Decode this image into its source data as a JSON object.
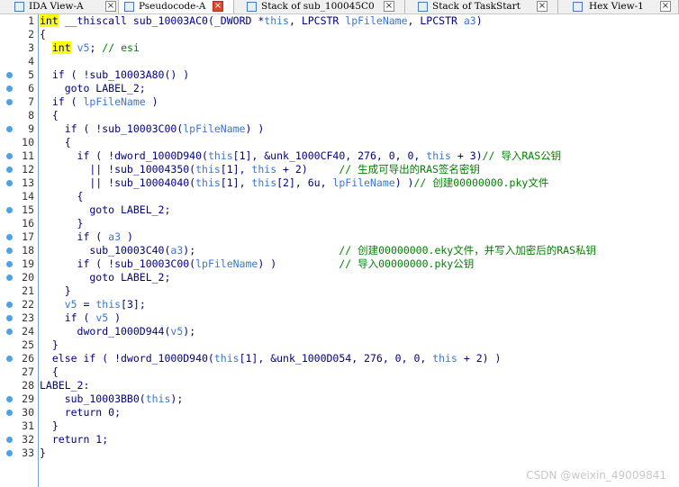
{
  "tabs": [
    {
      "label": "IDA View-A",
      "close": "×"
    },
    {
      "label": "Pseudocode-A",
      "close": "×"
    },
    {
      "label": "Stack of sub_100045C0",
      "close": "×"
    },
    {
      "label": "Stack of TaskStart",
      "close": "×"
    },
    {
      "label": "Hex View-1",
      "close": "×"
    }
  ],
  "active_tab": "Pseudocode-A",
  "colors": {
    "breakpoint": "#4aa3e6",
    "keyword_highlight": "#ffff00",
    "param": "#3b76d0",
    "comment": "#007f00",
    "code": "#000080"
  },
  "code": {
    "lines": [
      {
        "n": "1",
        "bp": false,
        "t": "int __thiscall sub_10003AC0(_DWORD *this, LPCSTR lpFileName, LPCSTR a3)"
      },
      {
        "n": "2",
        "bp": false,
        "t": "{"
      },
      {
        "n": "3",
        "bp": false,
        "t": "  int v5; // esi"
      },
      {
        "n": "4",
        "bp": false,
        "t": ""
      },
      {
        "n": "5",
        "bp": true,
        "t": "  if ( !sub_10003A80() )"
      },
      {
        "n": "6",
        "bp": true,
        "t": "    goto LABEL_2;"
      },
      {
        "n": "7",
        "bp": true,
        "t": "  if ( lpFileName )"
      },
      {
        "n": "8",
        "bp": false,
        "t": "  {"
      },
      {
        "n": "9",
        "bp": true,
        "t": "    if ( !sub_10003C00(lpFileName) )"
      },
      {
        "n": "10",
        "bp": false,
        "t": "    {"
      },
      {
        "n": "11",
        "bp": true,
        "t": "      if ( !dword_1000D940(this[1], &unk_1000CF40, 276, 0, 0, this + 3)// 导入RAS公钥"
      },
      {
        "n": "12",
        "bp": true,
        "t": "        || !sub_10004350(this[1], this + 2)     // 生成可导出的RAS签名密钥"
      },
      {
        "n": "13",
        "bp": true,
        "t": "        || !sub_10004040(this[1], this[2], 6u, lpFileName) )// 创建00000000.pky文件"
      },
      {
        "n": "14",
        "bp": false,
        "t": "      {"
      },
      {
        "n": "15",
        "bp": true,
        "t": "        goto LABEL_2;"
      },
      {
        "n": "16",
        "bp": false,
        "t": "      }"
      },
      {
        "n": "17",
        "bp": true,
        "t": "      if ( a3 )"
      },
      {
        "n": "18",
        "bp": true,
        "t": "        sub_10003C40(a3);                       // 创建00000000.eky文件，并写入加密后的RAS私钥"
      },
      {
        "n": "19",
        "bp": true,
        "t": "      if ( !sub_10003C00(lpFileName) )          // 导入00000000.pky公钥"
      },
      {
        "n": "20",
        "bp": true,
        "t": "        goto LABEL_2;"
      },
      {
        "n": "21",
        "bp": false,
        "t": "    }"
      },
      {
        "n": "22",
        "bp": true,
        "t": "    v5 = this[3];"
      },
      {
        "n": "23",
        "bp": true,
        "t": "    if ( v5 )"
      },
      {
        "n": "24",
        "bp": true,
        "t": "      dword_1000D944(v5);"
      },
      {
        "n": "25",
        "bp": false,
        "t": "  }"
      },
      {
        "n": "26",
        "bp": true,
        "t": "  else if ( !dword_1000D940(this[1], &unk_1000D054, 276, 0, 0, this + 2) )"
      },
      {
        "n": "27",
        "bp": false,
        "t": "  {"
      },
      {
        "n": "28",
        "bp": false,
        "t": "LABEL_2:"
      },
      {
        "n": "29",
        "bp": true,
        "t": "    sub_10003BB0(this);"
      },
      {
        "n": "30",
        "bp": true,
        "t": "    return 0;"
      },
      {
        "n": "31",
        "bp": false,
        "t": "  }"
      },
      {
        "n": "32",
        "bp": true,
        "t": "  return 1;"
      },
      {
        "n": "33",
        "bp": true,
        "t": "}"
      }
    ]
  },
  "watermark": "CSDN @weixin_49009841"
}
